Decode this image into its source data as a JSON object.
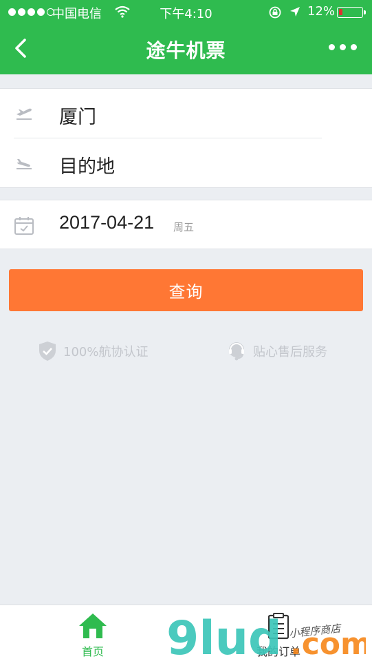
{
  "status_bar": {
    "carrier": "中国电信",
    "time": "下午4:10",
    "battery": "12%",
    "battery_level": 0.12,
    "signal_bars": 4,
    "icons": [
      "wifi-icon",
      "orientation-lock-icon",
      "location-arrow-icon"
    ]
  },
  "nav": {
    "title": "途牛机票",
    "back_icon": "chevron-left-icon",
    "more_icon": "ellipsis-icon"
  },
  "form": {
    "departure": {
      "value": "厦门",
      "icon": "takeoff-icon"
    },
    "destination": {
      "value": "目的地",
      "icon": "landing-icon"
    },
    "date": {
      "value": "2017-04-21",
      "weekday": "周五",
      "icon": "calendar-icon"
    }
  },
  "search_button": "查询",
  "features": [
    {
      "label": "100%航协认证",
      "icon": "shield-check-icon"
    },
    {
      "label": "贴心售后服务",
      "icon": "headset-icon"
    }
  ],
  "tabbar": {
    "home": {
      "label": "首页",
      "icon": "home-icon"
    },
    "orders": {
      "label": "我的订单",
      "icon": "clipboard-icon"
    }
  },
  "watermark": {
    "brand": "9lud.com",
    "tagline": "小程序商店"
  },
  "colors": {
    "brand_green": "#2fbb4f",
    "accent_orange": "#ff7734",
    "background": "#ebeef2",
    "watermark_teal": "#3cc6b9",
    "watermark_orange": "#f7891e"
  }
}
